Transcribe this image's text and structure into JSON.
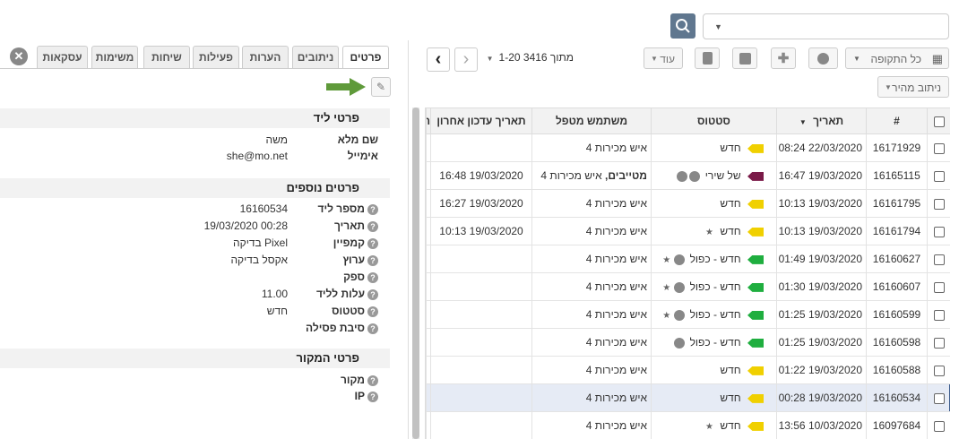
{
  "search": {
    "button_icon": "search-icon"
  },
  "toolbar": {
    "period_label": "כל התקופה",
    "more_label": "עוד",
    "quick_filter_label": "ניתוב מהיר",
    "paging_text": "1-20 מתוך 3416"
  },
  "table": {
    "headers": {
      "id": "#",
      "date": "תאריך",
      "status": "סטטוס",
      "handler": "משתמש מטפל",
      "last_update": "תאריך עדכון אחרון",
      "extra": "ת"
    },
    "rows": [
      {
        "id": "16171929",
        "date": "22/03/2020 08:24",
        "status": "חדש",
        "tag": "yellow",
        "handler": "איש מכירות 4",
        "last_update": ""
      },
      {
        "id": "16165115",
        "date": "19/03/2020 16:47",
        "status": "של שירי",
        "tag": "purple",
        "handler_bold": "מטייבים,",
        "handler": " איש מכירות 4",
        "last_update": "19/03/2020 16:48"
      },
      {
        "id": "16161795",
        "date": "19/03/2020 10:13",
        "status": "חדש",
        "tag": "yellow",
        "handler": "איש מכירות 4",
        "last_update": "19/03/2020 16:27"
      },
      {
        "id": "16161794",
        "date": "19/03/2020 10:13",
        "status": "חדש",
        "tag": "yellow",
        "handler": "איש מכירות 4",
        "last_update": "19/03/2020 10:13"
      },
      {
        "id": "16160627",
        "date": "19/03/2020 01:49",
        "status": "חדש - כפול",
        "tag": "green",
        "handler": "איש מכירות 4",
        "last_update": ""
      },
      {
        "id": "16160607",
        "date": "19/03/2020 01:30",
        "status": "חדש - כפול",
        "tag": "green",
        "handler": "איש מכירות 4",
        "last_update": ""
      },
      {
        "id": "16160599",
        "date": "19/03/2020 01:25",
        "status": "חדש - כפול",
        "tag": "green",
        "handler": "איש מכירות 4",
        "last_update": ""
      },
      {
        "id": "16160598",
        "date": "19/03/2020 01:25",
        "status": "חדש - כפול",
        "tag": "green",
        "handler": "איש מכירות 4",
        "last_update": ""
      },
      {
        "id": "16160588",
        "date": "19/03/2020 01:22",
        "status": "חדש",
        "tag": "yellow",
        "handler": "איש מכירות 4",
        "last_update": ""
      },
      {
        "id": "16160534",
        "date": "19/03/2020 00:28",
        "status": "חדש",
        "tag": "yellow",
        "handler": "איש מכירות 4",
        "last_update": ""
      },
      {
        "id": "16097684",
        "date": "10/03/2020 13:56",
        "status": "חדש",
        "tag": "yellow",
        "handler": "איש מכירות 4",
        "last_update": ""
      }
    ]
  },
  "tabs": [
    "פרטים",
    "ניתובים",
    "הערות",
    "פעילות",
    "שיחות",
    "משימות",
    "עסקאות"
  ],
  "details": {
    "lead_section": "פרטי ליד",
    "full_name_label": "שם מלא",
    "full_name": "משה",
    "email_label": "אימייל",
    "email": "she@mo.net",
    "extra_section": "פרטים נוספים",
    "lead_no_label": "מספר ליד",
    "lead_no": "16160534",
    "date_label": "תאריך",
    "date": "19/03/2020 00:28",
    "campaign_label": "קמפיין",
    "campaign": "בדיקה Pixel",
    "channel_label": "ערוץ",
    "channel": "אקסל בדיקה",
    "supplier_label": "ספק",
    "cost_label": "עלות לליד",
    "cost": "11.00",
    "status_label": "סטטוס",
    "status": "חדש",
    "reject_label": "סיבת פסילה",
    "source_section": "פרטי המקור",
    "source_label": "מקור",
    "ip_label": "IP"
  },
  "colors": {
    "search_button": "#60778f",
    "arrow": "#5f9a3a",
    "tag_yellow": "#f0d000",
    "tag_green": "#1fae3f",
    "tag_purple": "#7a1a48"
  }
}
